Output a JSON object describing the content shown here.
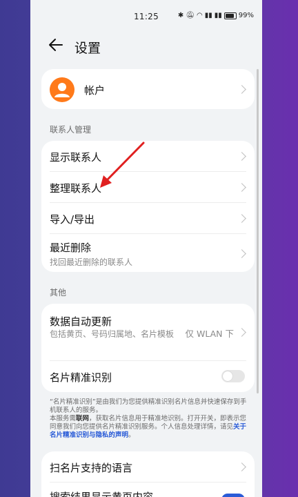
{
  "status_bar": {
    "time": "11:25",
    "battery": "99%"
  },
  "header": {
    "title": "设置"
  },
  "account": {
    "label": "帐户"
  },
  "contacts_section": {
    "title": "联系人管理",
    "items": [
      {
        "label": "显示联系人"
      },
      {
        "label": "整理联系人"
      },
      {
        "label": "导入/导出"
      },
      {
        "label": "最近删除",
        "sub": "找回最近删除的联系人"
      }
    ]
  },
  "other_section": {
    "title": "其他",
    "auto_update": {
      "label": "数据自动更新",
      "sub": "包括黄页、号码归属地、名片模板",
      "value": "仅 WLAN 下"
    },
    "card_recognition": {
      "label": "名片精准识别",
      "enabled": false
    }
  },
  "note": {
    "p1": "“名片精准识别”是由我们为您提供精准识别名片信息并快速保存到手机联系人的服务。",
    "p2a": "本服务需",
    "p2b": "联网",
    "p2c": "，获取名片信息用于精准地识别。打开开关，即表示您同意我们向您提供名片精准识别服务。个人信息处理详情，请见",
    "p2link": "关于名片精准识别与隐私的声明",
    "p2end": "。"
  },
  "bottom_section": {
    "items": [
      {
        "label": "扫名片支持的语言"
      },
      {
        "label": "搜索结果显示黄页内容"
      }
    ]
  },
  "colors": {
    "accent_orange": "#ff7a1a",
    "annotation_red": "#e02020",
    "link_blue": "#2a5bd7"
  }
}
